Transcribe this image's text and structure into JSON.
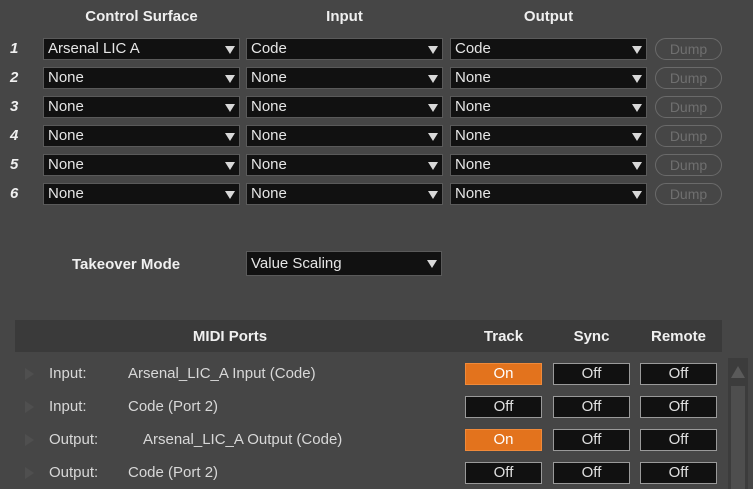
{
  "headers": {
    "control_surface": "Control Surface",
    "input": "Input",
    "output": "Output"
  },
  "surfaces": [
    {
      "num": "1",
      "surface": "Arsenal LIC A",
      "input": "Code",
      "output": "Code",
      "dump": "Dump"
    },
    {
      "num": "2",
      "surface": "None",
      "input": "None",
      "output": "None",
      "dump": "Dump"
    },
    {
      "num": "3",
      "surface": "None",
      "input": "None",
      "output": "None",
      "dump": "Dump"
    },
    {
      "num": "4",
      "surface": "None",
      "input": "None",
      "output": "None",
      "dump": "Dump"
    },
    {
      "num": "5",
      "surface": "None",
      "input": "None",
      "output": "None",
      "dump": "Dump"
    },
    {
      "num": "6",
      "surface": "None",
      "input": "None",
      "output": "None",
      "dump": "Dump"
    }
  ],
  "takeover": {
    "label": "Takeover Mode",
    "value": "Value Scaling"
  },
  "midi_ports": {
    "title": "MIDI Ports",
    "columns": {
      "track": "Track",
      "sync": "Sync",
      "remote": "Remote"
    },
    "rows": [
      {
        "type": "Input:",
        "name": "Arsenal_LIC_A Input (Code)",
        "track": "On",
        "sync": "Off",
        "remote": "Off"
      },
      {
        "type": "Input:",
        "name": "Code (Port 2)",
        "track": "Off",
        "sync": "Off",
        "remote": "Off"
      },
      {
        "type": "Output:",
        "name": "Arsenal_LIC_A Output (Code)",
        "track": "On",
        "sync": "Off",
        "remote": "Off"
      },
      {
        "type": "Output:",
        "name": "Code (Port 2)",
        "track": "Off",
        "sync": "Off",
        "remote": "Off"
      }
    ]
  },
  "colors": {
    "panel_bg": "#464646",
    "field_bg": "#111111",
    "toggle_on": "#e3731d"
  }
}
